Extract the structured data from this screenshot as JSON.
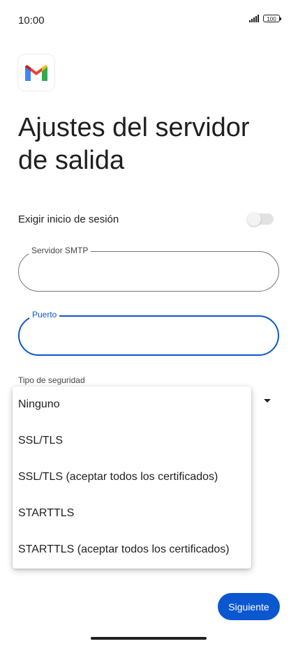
{
  "status_bar": {
    "time": "10:00",
    "battery": "100",
    "signal_icon": "signal-bars-icon",
    "battery_icon": "battery-icon"
  },
  "header": {
    "logo_icon": "gmail-logo-icon",
    "title": "Ajustes del servidor de salida"
  },
  "form": {
    "require_login": {
      "label": "Exigir inicio de sesión",
      "enabled": false
    },
    "smtp_server": {
      "label": "Servidor SMTP",
      "value": ""
    },
    "port": {
      "label": "Puerto",
      "value": "",
      "focused": true
    },
    "security_type": {
      "label": "Tipo de seguridad",
      "options": [
        "Ninguno",
        "SSL/TLS",
        "SSL/TLS (aceptar todos los certificados)",
        "STARTTLS",
        "STARTTLS (aceptar todos los certificados)"
      ]
    }
  },
  "footer": {
    "next_label": "Siguiente"
  },
  "colors": {
    "accent": "#0b57d0",
    "text": "#1f1f1f",
    "outline": "#747775"
  }
}
